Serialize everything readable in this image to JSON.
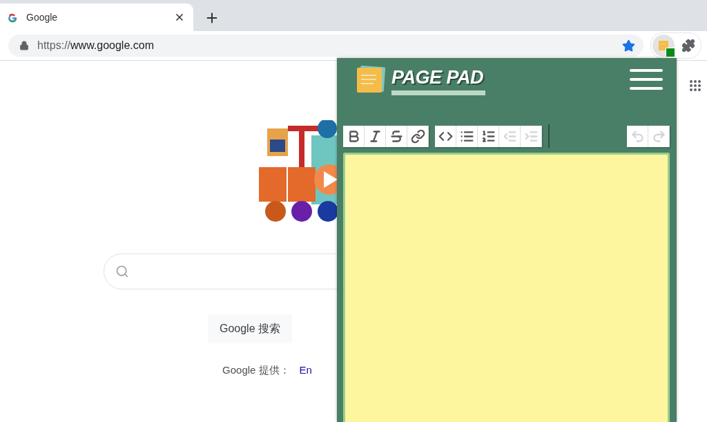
{
  "browser": {
    "tab": {
      "title": "Google",
      "selected": true
    },
    "address": {
      "scheme": "https://",
      "host": "www.google.com"
    },
    "bookmarked": true
  },
  "google_page": {
    "search_button": "Google 搜索",
    "offered_label": "Google 提供：",
    "language_link": "En"
  },
  "page_pad": {
    "title": "PAGE PAD",
    "toolbar": [
      [
        {
          "kind": "bold",
          "disabled": false
        },
        {
          "kind": "italic",
          "disabled": false
        },
        {
          "kind": "strike",
          "disabled": false
        },
        {
          "kind": "link",
          "disabled": false
        }
      ],
      [
        {
          "kind": "code",
          "disabled": false
        },
        {
          "kind": "bullets",
          "disabled": false
        },
        {
          "kind": "numbers",
          "disabled": false
        },
        {
          "kind": "outdent",
          "disabled": true
        },
        {
          "kind": "indent",
          "disabled": true
        }
      ],
      [
        {
          "kind": "undo",
          "disabled": true
        },
        {
          "kind": "redo",
          "disabled": true
        }
      ]
    ]
  }
}
